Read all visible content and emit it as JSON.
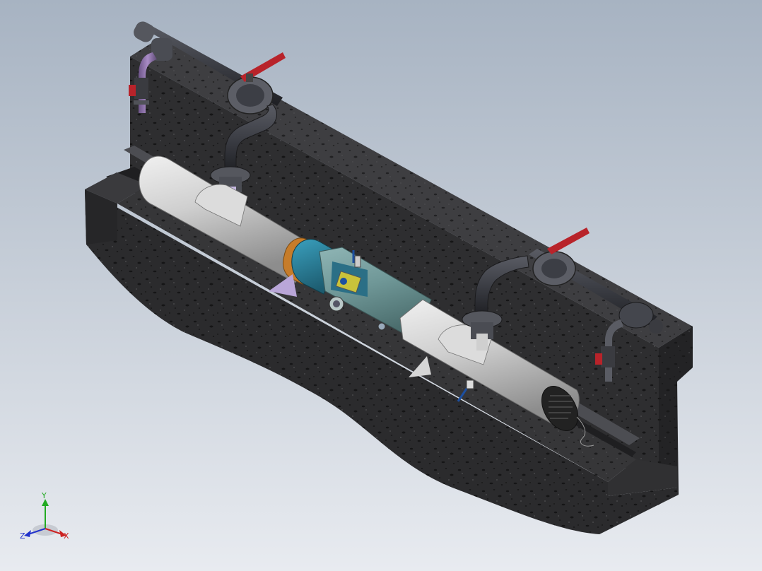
{
  "scene": {
    "background": {
      "top": "#a7b3c2",
      "bottom": "#e8ebf0"
    },
    "concrete": {
      "top": "#3a3a3c",
      "front": "#2c2c2e",
      "side": "#242426",
      "speckle": "#151516"
    },
    "pipe_grey": "#cfcfcf",
    "pipe_teal": "#6f9797",
    "collar_blue": "#2e7f98",
    "collar_orange": "#c67c2a",
    "process_pipe": "#3c3e45",
    "riser_violet": "#8a6fa6",
    "valve_handle": "#b8232a",
    "bracket": "#b9a6d8"
  },
  "triad": {
    "x": "X",
    "y": "Y",
    "z": "Z",
    "colors": {
      "x": "#cc2222",
      "y": "#22aa22",
      "z": "#2233cc"
    }
  }
}
